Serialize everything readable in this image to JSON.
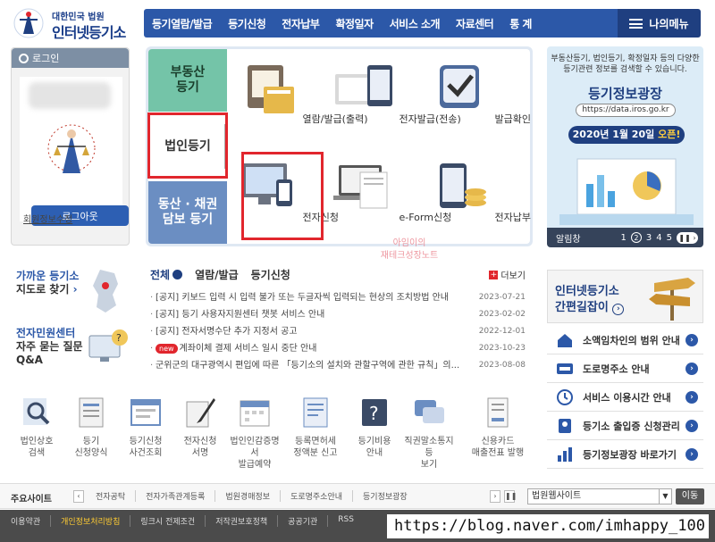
{
  "header": {
    "logo_top": "대한민국 법원",
    "logo_main": "인터넷등기소",
    "nav": [
      "등기열람/발급",
      "등기신청",
      "전자납부",
      "확정일자",
      "서비스 소개",
      "자료센터",
      "통 계"
    ],
    "my_menu": "나의메뉴"
  },
  "login": {
    "title": "로그인",
    "logout": "로그아웃",
    "edit_profile": "회원정보수정"
  },
  "service": {
    "tabs": [
      "부동산\n등기",
      "법인등기",
      "동산 · 채권\n담보 등기"
    ],
    "items": [
      "열람/발급(출력)",
      "전자발급(전송)",
      "발급확인",
      "전자신청",
      "e-Form신청",
      "전자납부"
    ]
  },
  "banner": {
    "desc": "부동산등기, 법인등기, 확정일자 등의 다양한 등기관련 정보를 검색할 수 있습니다.",
    "title": "등기정보광장",
    "url": "https://data.iros.go.kr",
    "date": "2020년 1월 20일",
    "open": "오픈!",
    "footer_label": "알림창",
    "pages": [
      "1",
      "2",
      "3",
      "4",
      "5"
    ],
    "active_page": "2"
  },
  "side": {
    "near_office_1": "가까운 등기소",
    "near_office_2": "지도로 찾기",
    "center_1": "전자민원센터",
    "center_2": "자주 묻는 질문",
    "center_3": "Q&A"
  },
  "notice": {
    "tabs": [
      "전체",
      "열람/발급",
      "등기신청"
    ],
    "more": "더보기",
    "new_label": "new",
    "items": [
      {
        "text": "[공지] 키보드 입력 시 입력 불가 또는 두글자씩 입력되는 현상의 조치방법 안내",
        "date": "2023-07-21"
      },
      {
        "text": "[공지] 등기 사용자지원센터 챗봇 서비스 안내",
        "date": "2023-02-02"
      },
      {
        "text": "[공지] 전자서명수단 추가 지정서 공고",
        "date": "2022-12-01"
      },
      {
        "text": "계좌이체 결제 서비스 일시 중단 안내",
        "date": "2023-10-23"
      },
      {
        "text": "군위군의 대구광역시 편입에 따른 「등기소의 설치와 관할구역에 관한 규칙」의...",
        "date": "2023-08-08"
      }
    ]
  },
  "watermark": {
    "line1": "아임이의",
    "line2": "재테크성장노트"
  },
  "guide": {
    "line1": "인터넷등기소",
    "line2": "간편길잡이"
  },
  "right_links": [
    "소액임차인의 범위 안내",
    "도로명주소 안내",
    "서비스 이용시간 안내",
    "등기소 출입증 신청관리",
    "등기정보광장 바로가기"
  ],
  "quick": [
    {
      "l1": "법인상호",
      "l2": "검색"
    },
    {
      "l1": "등기",
      "l2": "신청양식"
    },
    {
      "l1": "등기신청",
      "l2": "사건조회"
    },
    {
      "l1": "전자신청",
      "l2": "서명"
    },
    {
      "l1": "법인인감증명서",
      "l2": "발급예약"
    },
    {
      "l1": "등록면허세",
      "l2": "정액분 신고"
    },
    {
      "l1": "등기비용",
      "l2": "안내"
    },
    {
      "l1": "직권말소통지등",
      "l2": "보기"
    },
    {
      "l1": "신용카드",
      "l2": "매출전표 발행"
    }
  ],
  "sites": {
    "label": "주요사이트",
    "list": [
      "전자공탁",
      "전자가족관계등록",
      "법원경매정보",
      "도로명주소안내",
      "등기정보광장"
    ],
    "select": "법원웹사이트",
    "go": "이동"
  },
  "footer": {
    "links": [
      "이용약관",
      "개인정보처리방침",
      "링크시 전제조건",
      "저작권보호정책",
      "공공기관",
      "RSS"
    ]
  },
  "overlay_url": "https://blog.naver.com/imhappy_100",
  "colors": {
    "primary": "#2c58a8",
    "dark": "#1f3f80",
    "highlight": "#e1262d",
    "green_tab": "#74c4a8"
  }
}
